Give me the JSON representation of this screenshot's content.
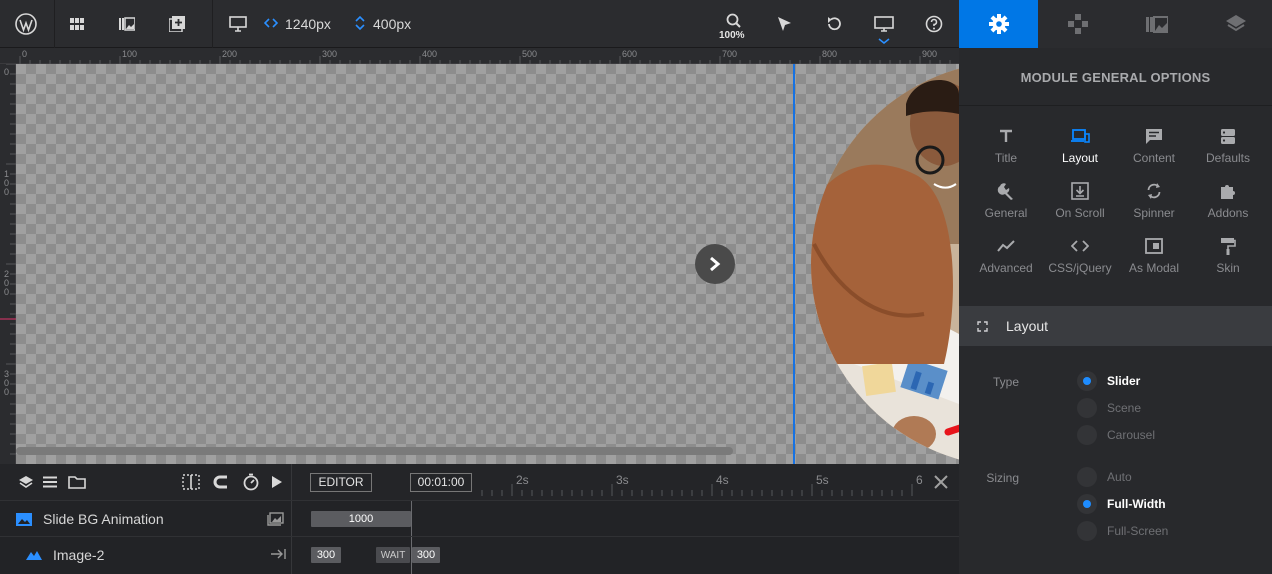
{
  "toolbar": {
    "width_value": "1240px",
    "height_value": "400px",
    "zoom": "100%"
  },
  "ruler": {
    "h_ticks": [
      "0",
      "100",
      "200",
      "300",
      "400",
      "500",
      "600",
      "700",
      "800",
      "900"
    ],
    "v_ticks": [
      "0",
      "1\n0\n0",
      "2\n0\n0",
      "3\n0\n0"
    ]
  },
  "timeline": {
    "editor_label": "EDITOR",
    "time": "00:01:00",
    "marks": [
      "2s",
      "3s",
      "4s",
      "5s",
      "6"
    ],
    "rows": [
      {
        "name": "Slide BG Animation",
        "bar": "1000"
      },
      {
        "name": "Image-2",
        "bar1": "300",
        "wait": "WAIT",
        "bar2": "300"
      }
    ]
  },
  "panel": {
    "title": "MODULE GENERAL OPTIONS",
    "modules": [
      "Title",
      "Layout",
      "Content",
      "Defaults",
      "General",
      "On Scroll",
      "Spinner",
      "Addons",
      "Advanced",
      "CSS/jQuery",
      "As Modal",
      "Skin"
    ],
    "section": "Layout",
    "type_label": "Type",
    "type_options": [
      "Slider",
      "Scene",
      "Carousel"
    ],
    "sizing_label": "Sizing",
    "sizing_options": [
      "Auto",
      "Full-Width",
      "Full-Screen"
    ]
  },
  "colors": {
    "accent": "#0077e6",
    "arrow": "#e8141b"
  }
}
